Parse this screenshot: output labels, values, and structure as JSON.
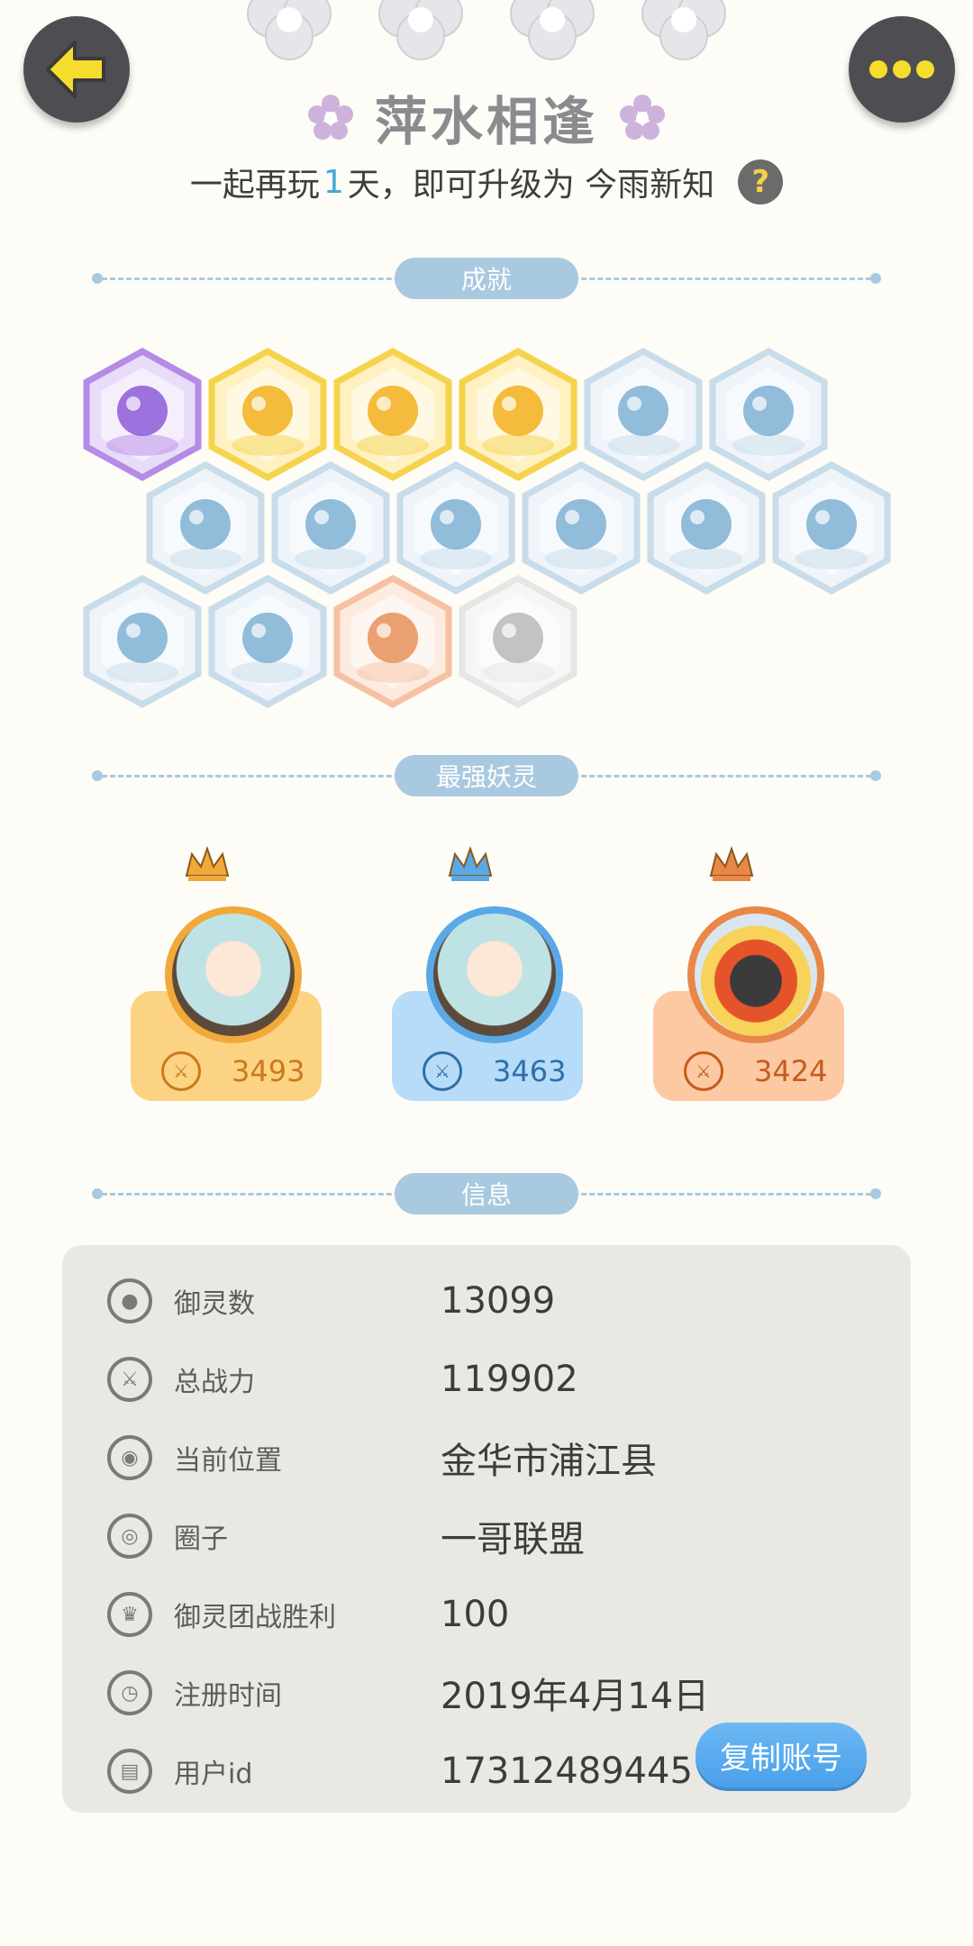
{
  "header": {
    "title": "萍水相逢",
    "subtitle_prefix": "一起再玩",
    "subtitle_days": "1",
    "subtitle_suffix": "天，即可升级为 今雨新知",
    "help_glyph": "?"
  },
  "sections": {
    "achievements": "成就",
    "strongest": "最强妖灵",
    "info": "信息"
  },
  "achievements": [
    {
      "name": "badge-purple-cat",
      "tier": "purple"
    },
    {
      "name": "badge-gold-sun",
      "tier": "gold"
    },
    {
      "name": "badge-gold-orb",
      "tier": "gold"
    },
    {
      "name": "badge-gold-fish",
      "tier": "gold"
    },
    {
      "name": "badge-blue-shoe",
      "tier": "blue"
    },
    {
      "name": "badge-blue-moon",
      "tier": "blue"
    },
    {
      "name": "badge-blue-crystal",
      "tier": "blue"
    },
    {
      "name": "badge-blue-wave",
      "tier": "blue"
    },
    {
      "name": "badge-blue-figure",
      "tier": "blue"
    },
    {
      "name": "badge-blue-fox",
      "tier": "blue"
    },
    {
      "name": "badge-blue-taichi",
      "tier": "blue"
    },
    {
      "name": "badge-blue-scroll",
      "tier": "blue"
    },
    {
      "name": "badge-blue-beast",
      "tier": "blue"
    },
    {
      "name": "badge-blue-ghost",
      "tier": "blue"
    },
    {
      "name": "badge-orange-cart",
      "tier": "orange"
    },
    {
      "name": "badge-gray-book",
      "tier": "gray"
    }
  ],
  "strongest": [
    {
      "rank": 1,
      "score": "3493",
      "card_color": "#fbd383",
      "ring_color": "#f1a93a",
      "score_color": "#c97a1b"
    },
    {
      "rank": 2,
      "score": "3463",
      "card_color": "#b6dcf9",
      "ring_color": "#5aa9e6",
      "score_color": "#2f6fa8"
    },
    {
      "rank": 3,
      "score": "3424",
      "card_color": "#fdc9a2",
      "ring_color": "#e98748",
      "score_color": "#c25d1e"
    }
  ],
  "info": [
    {
      "label": "御灵数",
      "value": "13099",
      "icon": "spirit-icon"
    },
    {
      "label": "总战力",
      "value": "119902",
      "icon": "sword-icon"
    },
    {
      "label": "当前位置",
      "value": "金华市浦江县",
      "icon": "location-icon"
    },
    {
      "label": "圈子",
      "value": "一哥联盟",
      "icon": "circle-icon"
    },
    {
      "label": "御灵团战胜利",
      "value": "100",
      "icon": "victory-icon"
    },
    {
      "label": "注册时间",
      "value": "2019年4月14日",
      "icon": "clock-icon"
    },
    {
      "label": "用户id",
      "value": "17312489445",
      "icon": "id-icon"
    }
  ],
  "copy_button": "复制账号",
  "colors": {
    "background": "#fdfcf7",
    "divider": "#a9c9e0",
    "accent_blue": "#45a8d8",
    "panel": "#e9e8e3"
  }
}
